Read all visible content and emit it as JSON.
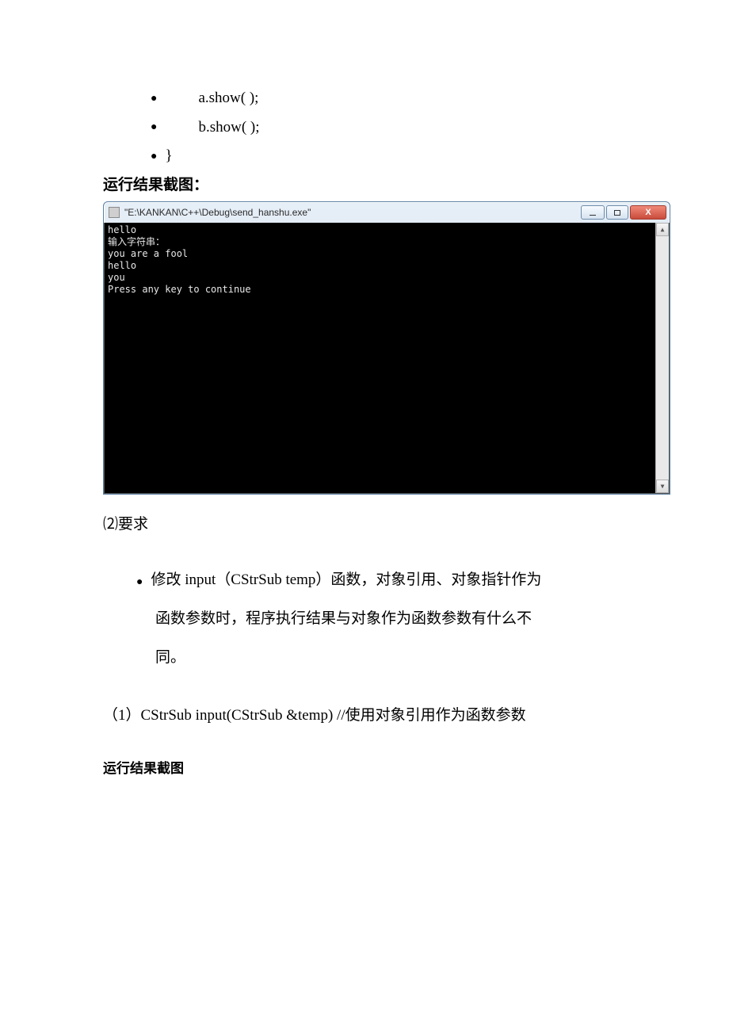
{
  "bullets": {
    "b1": "a.show( );",
    "b2": "b.show( );",
    "b3": "}"
  },
  "heading_result": "运行结果截图：",
  "console": {
    "title": "\"E:\\KANKAN\\C++\\Debug\\send_hanshu.exe\"",
    "lines": {
      "l1": "hello",
      "l2": "输入字符串：",
      "l3": "you are a fool",
      "l4": "hello",
      "l5": "you",
      "l6": "Press any key to continue"
    },
    "btn_close": "X"
  },
  "section2_label": "⑵要求",
  "requirement": {
    "line1": "修改 input（CStrSub temp）函数，对象引用、对象指针作为",
    "line2": "函数参数时，程序执行结果与对象作为函数参数有什么不",
    "line3": "同。"
  },
  "para1": "（1）CStrSub input(CStrSub &temp)  //使用对象引用作为函数参数",
  "heading_result2": "运行结果截图"
}
